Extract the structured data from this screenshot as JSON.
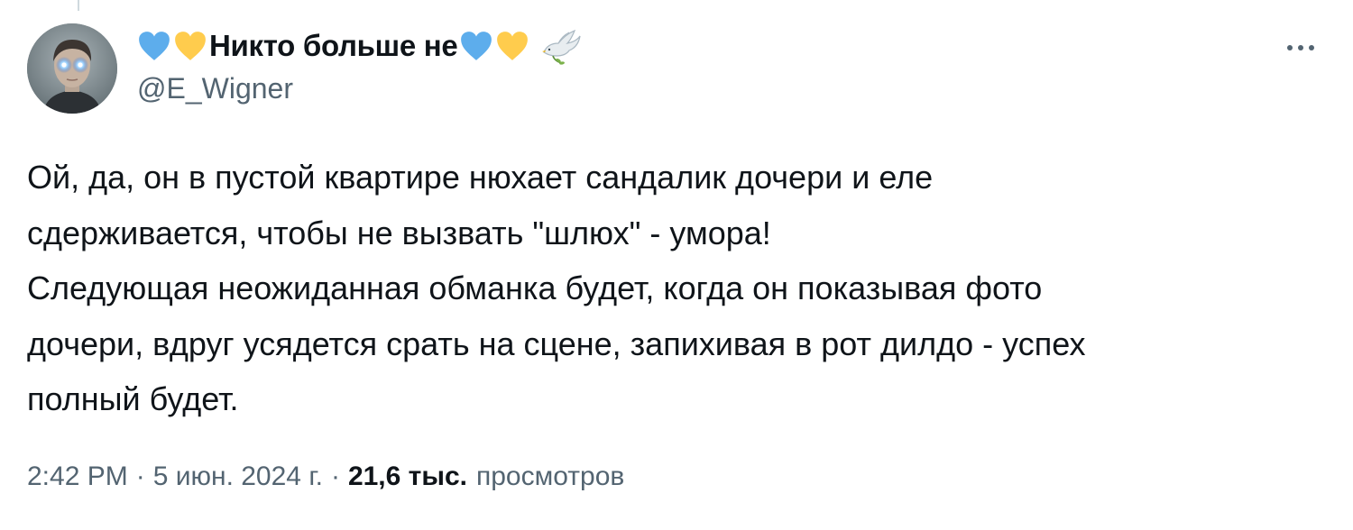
{
  "author": {
    "display_name": "Никто больше не",
    "handle": "@E_Wigner",
    "name_emoji_before": [
      "blue-heart",
      "yellow-heart"
    ],
    "name_emoji_after": [
      "blue-heart",
      "yellow-heart",
      "dove-of-peace"
    ]
  },
  "tweet": {
    "lines": [
      "Ой, да, он в пустой квартире нюхает сандалик дочери и еле",
      "сдерживается, чтобы не вызвать \"шлюх\" - умора!",
      "Следующая неожиданная обманка будет, когда он показывая фото",
      "дочери, вдруг усядется срать на сцене, запихивая в рот дилдо - успех",
      "полный будет."
    ]
  },
  "meta": {
    "time": "2:42 PM",
    "separator": "·",
    "date": "5 июн. 2024 г.",
    "views_count": "21,6 тыс.",
    "views_label": "просмотров"
  },
  "icons": {
    "more": "more-horizontal-icon"
  },
  "colors": {
    "text_primary": "#0f1419",
    "text_secondary": "#536471",
    "heart_blue": "#5dadec",
    "heart_yellow": "#ffcc4d"
  }
}
